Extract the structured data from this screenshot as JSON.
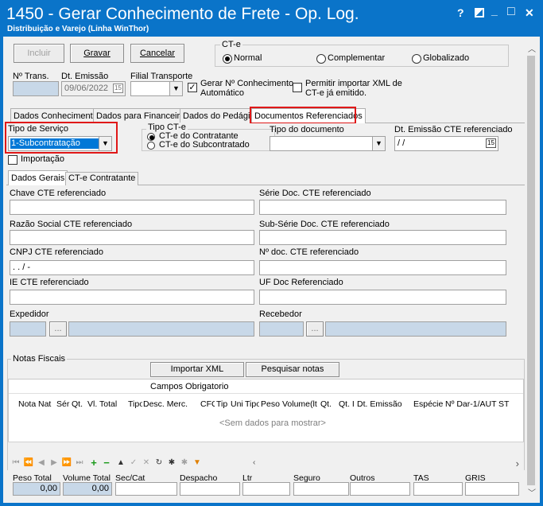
{
  "window": {
    "title": "1450 - Gerar Conhecimento de Frete - Op. Log.",
    "subtitle": "Distribuição e Varejo (Linha WinThor)",
    "help": "?",
    "minimize": "_",
    "restore": "□",
    "close": "✕"
  },
  "toolbar": {
    "incluir": "Incluir",
    "gravar": "Gravar",
    "cancelar": "Cancelar"
  },
  "cte": {
    "label": "CT-e",
    "normal": "Normal",
    "complementar": "Complementar",
    "globalizado": "Globalizado",
    "selected": "Normal"
  },
  "header": {
    "n_trans_label": "Nº Trans.",
    "n_trans_value": "",
    "dt_emissao_label": "Dt. Emissão",
    "dt_emissao_value": "09/06/2022",
    "filial_label": "Filial Transporte",
    "filial_value": "",
    "gerar_label_1": "Gerar Nº Conhecimento",
    "gerar_label_2": "Automático",
    "gerar_checked": "✓",
    "permitir_label_1": "Permitir importar XML de",
    "permitir_label_2": "CT-e já emitido."
  },
  "tabs": [
    {
      "label": "Dados Conhecimento"
    },
    {
      "label": "Dados para Financeiro"
    },
    {
      "label": "Dados do Pedágio"
    },
    {
      "label": "Documentos Referenciados"
    }
  ],
  "docs": {
    "tipo_servico_label": "Tipo de Serviço",
    "tipo_servico_value": "1-Subcontratação",
    "tipo_cte_label": "Tipo CT-e",
    "cte_contratante": "CT-e do Contratante",
    "cte_subcontratado": "CT-e do Subcontratado",
    "tipo_documento_label": "Tipo do documento",
    "tipo_documento_value": "",
    "dt_emissao_ref_label": "Dt. Emissão CTE referenciado",
    "dt_emissao_ref_value": " / /",
    "importacao_label": "Importação"
  },
  "subtabs": [
    {
      "label": "Dados Gerais"
    },
    {
      "label": "CT-e Contratante"
    }
  ],
  "dados_gerais": {
    "chave_label": "Chave CTE referenciado",
    "serie_label": "Série Doc. CTE referenciado",
    "razao_label": "Razão Social CTE referenciado",
    "subserie_label": "Sub-Série Doc. CTE referenciado",
    "cnpj_label": "CNPJ CTE referenciado",
    "cnpj_value": " .  .  /  -",
    "ndoc_label": "Nº doc. CTE referenciado",
    "ie_label": "IE CTE referenciado",
    "uf_label": "UF Doc Referenciado",
    "expedidor_label": "Expedidor",
    "recebedor_label": "Recebedor",
    "ellipsis": "..."
  },
  "notas": {
    "label": "Notas Fiscais",
    "importar_xml": "Importar XML",
    "pesquisar_notas": "Pesquisar notas",
    "campos_obrigatorio": "Campos Obrigatorio",
    "columns": [
      "Nota",
      "Nat",
      "Sér",
      "Qt.",
      "Vl. Total",
      "Tipo",
      "Desc. Merc.",
      "CFO",
      "Tip",
      "Uni",
      "Tipo",
      "Peso",
      "Volume(lt",
      "Qt.",
      "Qt. I",
      "Dt. Emissão",
      "Espécie",
      "Nº Dar-1/AUT",
      "ST"
    ],
    "empty_text": "<Sem dados para mostrar>",
    "nav": [
      "⏮",
      "⏪",
      "◀",
      "▶",
      "⏩",
      "⏭",
      "+",
      "−",
      "▲",
      "✓",
      "✕",
      "↻",
      "✱",
      "✱",
      "▼"
    ]
  },
  "totals": {
    "peso_total_label": "Peso Total",
    "peso_total_value": "0,00",
    "volume_total_label": "Volume Total",
    "volume_total_value": "0,00",
    "seccat_label": "Sec/Cat",
    "despacho_label": "Despacho",
    "ltr_label": "Ltr",
    "seguro_label": "Seguro",
    "outros_label": "Outros",
    "tas_label": "TAS",
    "gris_label": "GRIS"
  },
  "colors": {
    "titlebar": "#0a74c9",
    "highlight": "#e01818",
    "selection": "#0078d7"
  }
}
